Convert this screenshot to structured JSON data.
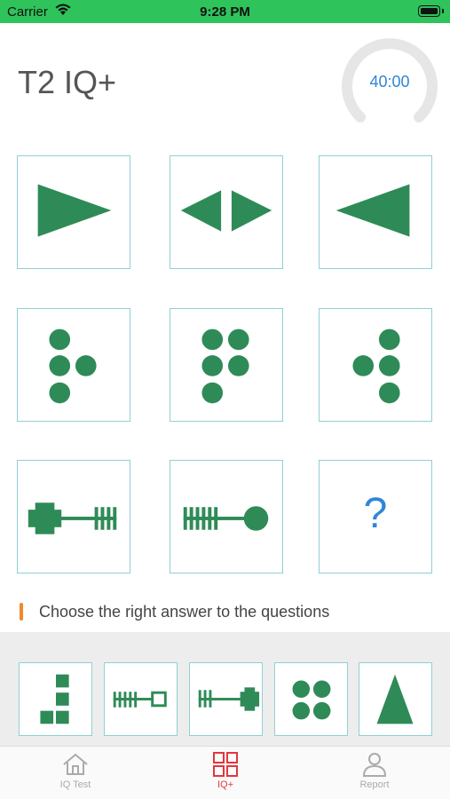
{
  "status_bar": {
    "carrier": "Carrier",
    "time": "9:28 PM"
  },
  "header": {
    "title": "T2 IQ+",
    "timer": "40:00"
  },
  "puzzle": {
    "cells": [
      {
        "icon": "triangle-right-icon"
      },
      {
        "icon": "triangles-facing-out-icon"
      },
      {
        "icon": "triangle-left-icon"
      },
      {
        "icon": "dots-four-icon"
      },
      {
        "icon": "dots-five-icon"
      },
      {
        "icon": "dots-four-mirrored-icon"
      },
      {
        "icon": "key-cross-icon"
      },
      {
        "icon": "key-round-icon"
      },
      {
        "icon": "question-mark-icon",
        "label": "?"
      }
    ]
  },
  "instruction": "Choose the right answer to the questions",
  "answers": [
    {
      "icon": "blocks-stairs-icon"
    },
    {
      "icon": "key-square-icon"
    },
    {
      "icon": "key-cross-reversed-icon"
    },
    {
      "icon": "dots-four-grid-icon"
    },
    {
      "icon": "triangle-up-icon"
    }
  ],
  "tabs": [
    {
      "label": "IQ Test",
      "icon": "house-icon",
      "active": false
    },
    {
      "label": "IQ+",
      "icon": "grid-icon",
      "active": true
    },
    {
      "label": "Report",
      "icon": "person-icon",
      "active": false
    }
  ],
  "colors": {
    "accent": "#2e8b57",
    "status_green": "#2ec35b",
    "timer_blue": "#2f86d6",
    "active_tab": "#e0383e",
    "cell_border": "#8fd0d3"
  }
}
